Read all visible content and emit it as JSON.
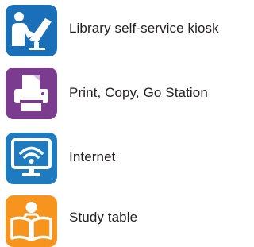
{
  "legend": {
    "items": [
      {
        "icon": "kiosk-user-icon",
        "label": "Library self-service kiosk",
        "color": "#1a6fb9"
      },
      {
        "icon": "printer-icon",
        "label": "Print, Copy, Go Station",
        "color": "#7b3b8f"
      },
      {
        "icon": "wifi-monitor-icon",
        "label": "Internet",
        "color": "#1f7bbf"
      },
      {
        "icon": "reading-person-icon",
        "label": "Study table",
        "color": "#f6941e"
      }
    ]
  }
}
